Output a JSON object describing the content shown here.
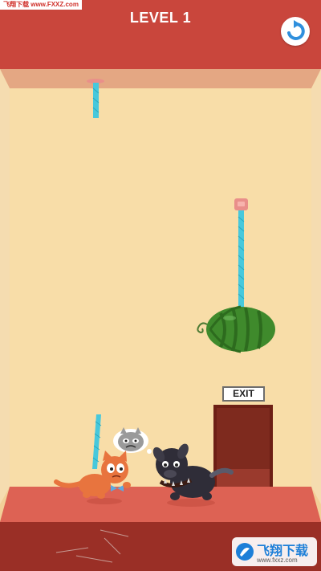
{
  "watermark_top": "飞翔下载 www.FXXZ.com",
  "header": {
    "level_label": "LEVEL 1"
  },
  "restart_icon": "refresh-icon",
  "exit_sign": "EXIT",
  "watermark_bottom": {
    "brand": "飞翔下载",
    "url": "www.fxxz.com"
  },
  "colors": {
    "ceiling": "#c9463c",
    "wall": "#f7dba6",
    "floor": "#d85e50",
    "rope": "#47c8dc",
    "exit_door": "#7a2418"
  }
}
